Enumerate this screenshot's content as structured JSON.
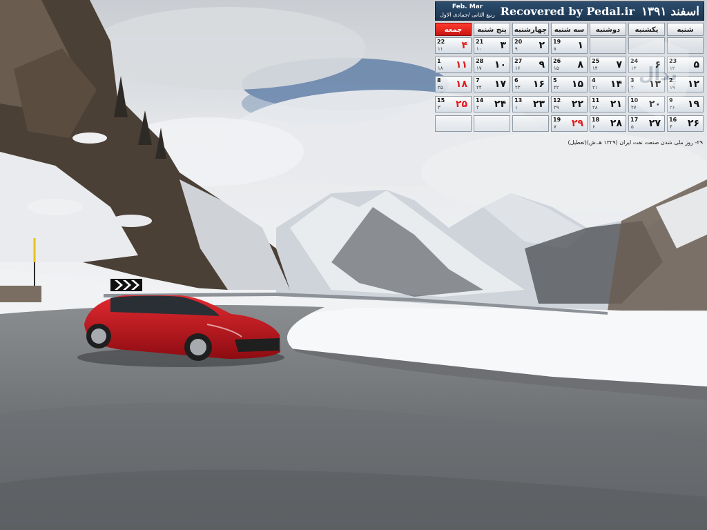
{
  "calendar": {
    "title": "Recovered by Pedal.ir",
    "month": "اسفند ۱۳۹۱",
    "gregorian_months": "Feb. Mar",
    "hijri_months": "ربیع الثانی /جمادی الاول",
    "weekdays": [
      "شنبه",
      "یکشنبه",
      "دوشنبه",
      "سه شنبه",
      "چهارشنبه",
      "پنج شنبه",
      "جمعه"
    ],
    "rows": [
      [
        {
          "p": "",
          "g": "",
          "h": "",
          "holiday": false
        },
        {
          "p": "",
          "g": "",
          "h": "",
          "holiday": false
        },
        {
          "p": "",
          "g": "",
          "h": "",
          "holiday": false
        },
        {
          "p": "۱",
          "g": "19",
          "h": "۸",
          "holiday": false
        },
        {
          "p": "۲",
          "g": "20",
          "h": "۹",
          "holiday": false
        },
        {
          "p": "۳",
          "g": "21",
          "h": "۱۰",
          "holiday": false
        },
        {
          "p": "۴",
          "g": "22",
          "h": "۱۱",
          "holiday": true
        }
      ],
      [
        {
          "p": "۵",
          "g": "23",
          "h": "۱۲",
          "holiday": false
        },
        {
          "p": "۶",
          "g": "24",
          "h": "۱۳",
          "holiday": false
        },
        {
          "p": "۷",
          "g": "25",
          "h": "۱۴",
          "holiday": false
        },
        {
          "p": "۸",
          "g": "26",
          "h": "۱۵",
          "holiday": false
        },
        {
          "p": "۹",
          "g": "27",
          "h": "۱۶",
          "holiday": false
        },
        {
          "p": "۱۰",
          "g": "28",
          "h": "۱۷",
          "holiday": false
        },
        {
          "p": "۱۱",
          "g": "1",
          "h": "۱۸",
          "holiday": true
        }
      ],
      [
        {
          "p": "۱۲",
          "g": "2",
          "h": "۱۹",
          "holiday": false
        },
        {
          "p": "۱۳",
          "g": "3",
          "h": "۲۰",
          "holiday": false
        },
        {
          "p": "۱۴",
          "g": "4",
          "h": "۲۱",
          "holiday": false
        },
        {
          "p": "۱۵",
          "g": "5",
          "h": "۲۲",
          "holiday": false
        },
        {
          "p": "۱۶",
          "g": "6",
          "h": "۲۳",
          "holiday": false
        },
        {
          "p": "۱۷",
          "g": "7",
          "h": "۲۴",
          "holiday": false
        },
        {
          "p": "۱۸",
          "g": "8",
          "h": "۲۵",
          "holiday": true
        }
      ],
      [
        {
          "p": "۱۹",
          "g": "9",
          "h": "۲۶",
          "holiday": false
        },
        {
          "p": "۲۰",
          "g": "10",
          "h": "۲۷",
          "holiday": false
        },
        {
          "p": "۲۱",
          "g": "11",
          "h": "۲۸",
          "holiday": false
        },
        {
          "p": "۲۲",
          "g": "12",
          "h": "۲۹",
          "holiday": false
        },
        {
          "p": "۲۳",
          "g": "13",
          "h": "۱",
          "holiday": false
        },
        {
          "p": "۲۴",
          "g": "14",
          "h": "۲",
          "holiday": false
        },
        {
          "p": "۲۵",
          "g": "15",
          "h": "۳",
          "holiday": true
        }
      ],
      [
        {
          "p": "۲۶",
          "g": "16",
          "h": "۴",
          "holiday": false
        },
        {
          "p": "۲۷",
          "g": "17",
          "h": "۵",
          "holiday": false
        },
        {
          "p": "۲۸",
          "g": "18",
          "h": "۶",
          "holiday": false
        },
        {
          "p": "۲۹",
          "g": "19",
          "h": "۷",
          "holiday": true
        },
        {
          "p": "",
          "g": "",
          "h": "",
          "holiday": false
        },
        {
          "p": "",
          "g": "",
          "h": "",
          "holiday": false
        },
        {
          "p": "",
          "g": "",
          "h": "",
          "holiday": false
        }
      ]
    ],
    "note": "۲۹- روز ملی شدن صنعت نفت ایران (۱۳۲۹ هـ.ش)(تعطیل)",
    "watermark_text": "پدال"
  },
  "colors": {
    "header_blue": "#1f3a57",
    "holiday_red": "#e21b1b",
    "friday_header": "#e0201b",
    "car_red": "#c8141c"
  },
  "icons": {
    "chevron_sign": "chevron-warning-sign-icon"
  }
}
